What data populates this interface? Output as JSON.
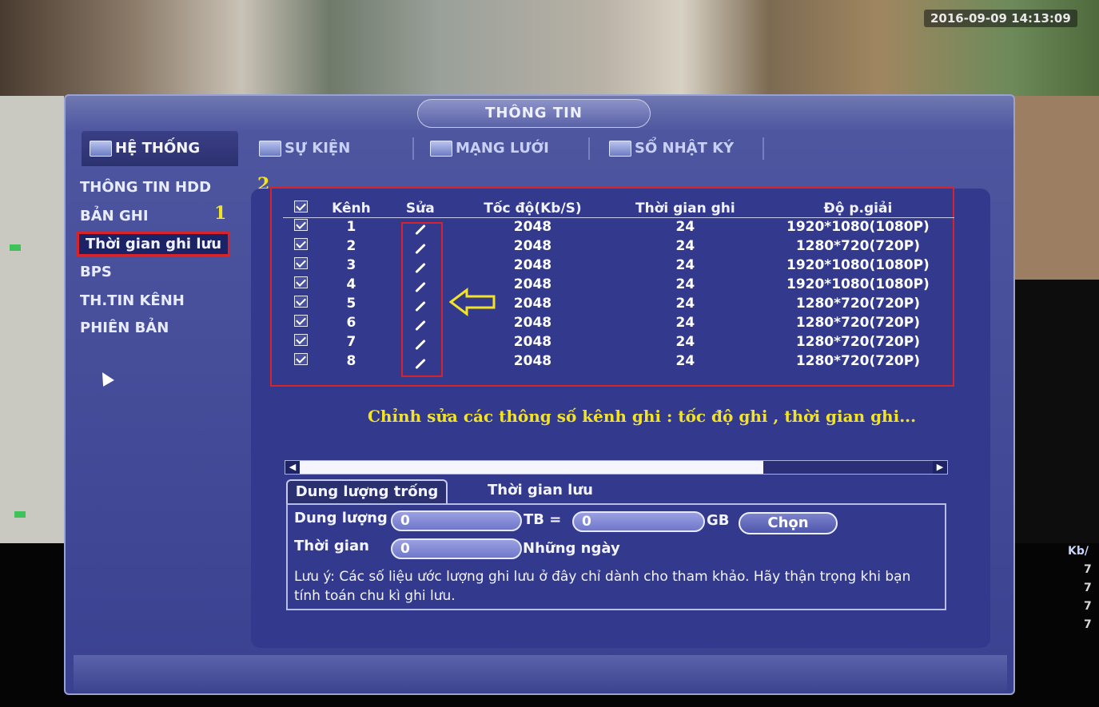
{
  "overlay": {
    "timestamp": "2016-09-09 14:13:09",
    "kb_label": "Kb/",
    "kb_values": [
      "7",
      "7",
      "7",
      "7"
    ]
  },
  "window": {
    "title": "THÔNG TIN"
  },
  "tabs": [
    {
      "label": "HỆ THỐNG",
      "icon": "monitor-icon"
    },
    {
      "label": "SỰ KIỆN",
      "icon": "event-icon"
    },
    {
      "label": "MẠNG LƯỚI",
      "icon": "network-icon"
    },
    {
      "label": "SỔ NHẬT KÝ",
      "icon": "log-book-icon"
    }
  ],
  "menu": [
    "THÔNG TIN HDD",
    "BẢN GHI",
    "Thời gian ghi lưu",
    "BPS",
    "TH.TIN KÊNH",
    "PHIÊN BẢN"
  ],
  "annotations": {
    "one": "1",
    "two": "2",
    "hint": "Chỉnh sửa các thông số kênh ghi : tốc độ ghi , thời gian ghi..."
  },
  "table": {
    "headers": [
      "Kênh",
      "Sửa",
      "Tốc độ(Kb/S)",
      "Thời gian ghi",
      "Độ p.giải"
    ],
    "rows": [
      {
        "ch": "1",
        "rate": "2048",
        "time": "24",
        "res": "1920*1080(1080P)"
      },
      {
        "ch": "2",
        "rate": "2048",
        "time": "24",
        "res": "1280*720(720P)"
      },
      {
        "ch": "3",
        "rate": "2048",
        "time": "24",
        "res": "1920*1080(1080P)"
      },
      {
        "ch": "4",
        "rate": "2048",
        "time": "24",
        "res": "1920*1080(1080P)"
      },
      {
        "ch": "5",
        "rate": "2048",
        "time": "24",
        "res": "1280*720(720P)"
      },
      {
        "ch": "6",
        "rate": "2048",
        "time": "24",
        "res": "1280*720(720P)"
      },
      {
        "ch": "7",
        "rate": "2048",
        "time": "24",
        "res": "1280*720(720P)"
      },
      {
        "ch": "8",
        "rate": "2048",
        "time": "24",
        "res": "1280*720(720P)"
      }
    ]
  },
  "subtabs": [
    "Dung lượng trống",
    "Thời gian lưu"
  ],
  "form": {
    "capacity_label": "Dung lượng",
    "capacity_value": "0",
    "tb_label": "TB =",
    "gb_value": "0",
    "gb_label": "GB",
    "choose_button": "Chọn",
    "time_label": "Thời gian",
    "time_value": "0",
    "days_label": "Những ngày",
    "note": "Lưu ý: Các số liệu ước lượng ghi lưu ở đây chỉ dành cho tham khảo. Hãy thận trọng khi bạn tính toán chu kì ghi lưu."
  }
}
